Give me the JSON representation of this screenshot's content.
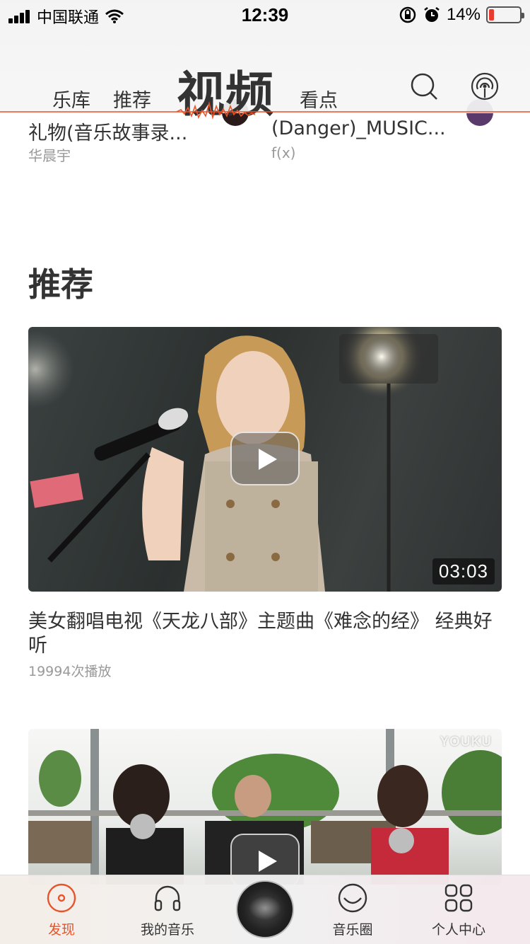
{
  "status_bar": {
    "carrier": "中国联通",
    "time": "12:39",
    "battery": "14%"
  },
  "top_nav": {
    "tabs": [
      "乐库",
      "推荐",
      "视频",
      "看点"
    ],
    "active_tab": "视频"
  },
  "top_cards": [
    {
      "title": "礼物(音乐故事录...",
      "artist": "华晨宇"
    },
    {
      "title": "(Danger)_MUSIC...",
      "artist": "f(x)"
    }
  ],
  "section": {
    "title": "推荐"
  },
  "videos": [
    {
      "title": "美女翻唱电视《天龙八部》主题曲《难念的经》 经典好听",
      "plays": "19994次播放",
      "duration": "03:03"
    },
    {
      "watermark": "YOUKU"
    }
  ],
  "tab_bar": {
    "items": [
      "发现",
      "我的音乐",
      "音乐圈",
      "个人中心"
    ],
    "active": "发现",
    "accent_color": "#e8542a"
  }
}
